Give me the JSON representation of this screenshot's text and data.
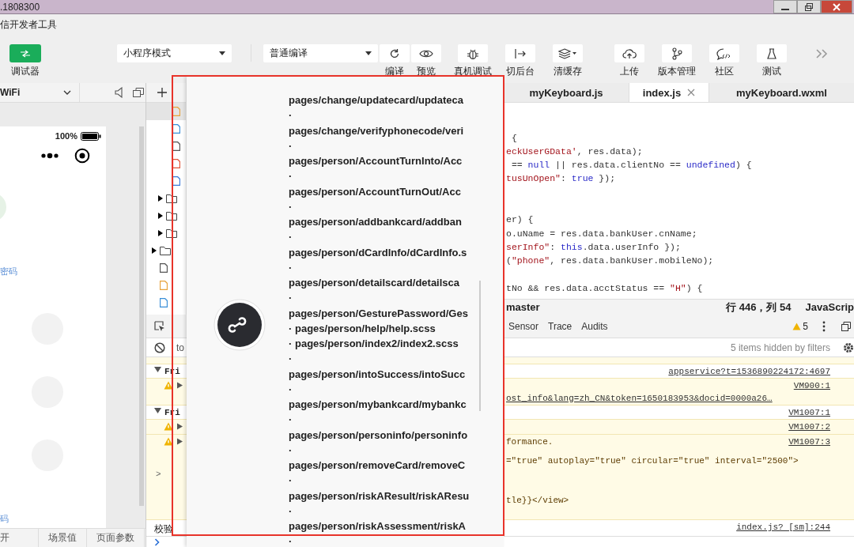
{
  "window": {
    "title": ".1808300"
  },
  "menu_bar": {
    "app_name": "信开发者工具"
  },
  "toolbar": {
    "debugger_label": "调试器",
    "mode_select": "小程序模式",
    "compile_select": "普通编译",
    "quick_actions": [
      {
        "kind": "compile",
        "label": "编译"
      },
      {
        "kind": "preview",
        "label": "预览"
      }
    ],
    "actions": [
      {
        "kind": "remote-debug",
        "label": "真机调试"
      },
      {
        "kind": "background",
        "label": "切后台"
      },
      {
        "kind": "cache",
        "label": "清缓存"
      }
    ],
    "publish_actions": [
      {
        "kind": "upload",
        "label": "上传"
      },
      {
        "kind": "version",
        "label": "版本管理"
      },
      {
        "kind": "community",
        "label": "社区"
      },
      {
        "kind": "test",
        "label": "测试"
      }
    ]
  },
  "simulator": {
    "network": "WiFi",
    "battery": "100%",
    "link_top": "密码",
    "link_bottom": "码",
    "bottom_tabs": [
      "开",
      "场景值",
      "页面参数"
    ]
  },
  "file_tree": [
    {
      "children": [
        {
          "children": [
            {
              "kind": "js",
              "selected": true
            },
            {
              "kind": "json",
              "selected": false
            },
            {
              "kind": "scss",
              "selected": false
            },
            {
              "kind": "wxml",
              "selected": false
            },
            {
              "kind": "wxss",
              "selected": false
            }
          ]
        },
        {
          "kind": "folder",
          "expanded": false,
          "selected": false
        },
        {
          "kind": "folder",
          "expanded": false,
          "selected": false
        },
        {
          "kind": "folder",
          "expanded": false,
          "selected": false
        }
      ]
    },
    {
      "kind": "folder",
      "expanded": false,
      "selected": false
    },
    {
      "kind": "file",
      "selected": false
    },
    {
      "kind": "js",
      "selected": false
    },
    {
      "kind": "json",
      "selected": false
    }
  ],
  "editor": {
    "tabs": [
      {
        "label": "myKeyboard.js",
        "selected": false
      },
      {
        "label": "index.js",
        "selected": true
      },
      {
        "label": "myKeyboard.wxml",
        "selected": false
      }
    ],
    "lines": [
      {
        "blank": true
      },
      {
        "blank": true
      },
      {
        "segments": [
          {
            "t": " {",
            "kind": "plain"
          }
        ]
      },
      {
        "segments": [
          {
            "t": "eckUserGData'",
            "kind": "string"
          },
          {
            "t": ", res.data);",
            "kind": "plain"
          }
        ]
      },
      {
        "segments": [
          {
            "t": " == ",
            "kind": "plain"
          },
          {
            "t": "null",
            "kind": "keyword"
          },
          {
            "t": " || res.data.clientNo == ",
            "kind": "plain"
          },
          {
            "t": "undefined",
            "kind": "keyword"
          },
          {
            "t": ") {",
            "kind": "plain"
          }
        ]
      },
      {
        "segments": [
          {
            "t": "tusUnOpen\"",
            "kind": "string"
          },
          {
            "t": ": ",
            "kind": "plain"
          },
          {
            "t": "true",
            "kind": "keyword"
          },
          {
            "t": " });",
            "kind": "plain"
          }
        ]
      },
      {
        "blank": true
      },
      {
        "blank": true
      },
      {
        "segments": [
          {
            "t": "er) {",
            "kind": "plain"
          }
        ]
      },
      {
        "segments": [
          {
            "t": "o.uName = res.data.bankUser.cnName;",
            "kind": "plain"
          }
        ]
      },
      {
        "segments": [
          {
            "t": "serInfo\"",
            "kind": "string"
          },
          {
            "t": ": ",
            "kind": "plain"
          },
          {
            "t": "this",
            "kind": "keyword"
          },
          {
            "t": ".data.userInfo });",
            "kind": "plain"
          }
        ]
      },
      {
        "segments": [
          {
            "t": "(",
            "kind": "plain"
          },
          {
            "t": "\"phone\"",
            "kind": "string"
          },
          {
            "t": ", res.data.bankUser.mobileNo);",
            "kind": "plain"
          }
        ]
      },
      {
        "blank": true
      },
      {
        "segments": [
          {
            "t": "tNo && res.data.acctStatus == ",
            "kind": "plain"
          },
          {
            "t": "\"H\"",
            "kind": "string"
          },
          {
            "t": ") {",
            "kind": "plain"
          }
        ]
      }
    ]
  },
  "status_bar": {
    "branch": "master",
    "position": "行 446，列 54",
    "language": "JavaScrip"
  },
  "devtools": {
    "tabs": [
      "Sensor",
      "Trace",
      "Audits"
    ],
    "warning_count": "5",
    "filter_text": "to",
    "hidden_note": "5 items hidden by filters",
    "console": [
      {
        "kind": "group",
        "label": "Fri",
        "expanded": true,
        "source": "appservice?t=1536890224172:4697"
      },
      {
        "kind": "warning",
        "expanded": false,
        "source": "VM900:1",
        "link": "ost_info&lang=zh_CN&token=1650183953&docid=0000a26…"
      },
      {
        "kind": "group",
        "label": "Fri",
        "expanded": true,
        "source": "VM1007:1"
      },
      {
        "kind": "warning",
        "expanded": false,
        "source": "VM1007:2"
      },
      {
        "kind": "warning",
        "expanded": false,
        "text": "formance.",
        "source": "VM1007:3",
        "frame_marker": ">",
        "frame_lines": [
          "=\"true\" autoplay=\"true\" circular=\"true\" interval=\"2500\">",
          "tle}}</view>"
        ]
      },
      {
        "kind": "log",
        "text": "校验",
        "source": "index.js? [sm]:244"
      }
    ]
  },
  "popup": {
    "items": [
      {
        "text": "pages/change/updatecard/updateca"
      },
      {
        "bullet": "·",
        "text": "pages/change/verifyphonecode/veri"
      },
      {
        "bullet": "·",
        "text": "pages/person/AccountTurnInto/Acc"
      },
      {
        "bullet": "·",
        "text": "pages/person/AccountTurnOut/Acc"
      },
      {
        "bullet": "·",
        "text": "pages/person/addbankcard/addban"
      },
      {
        "bullet": "·",
        "text": "pages/person/dCardInfo/dCardInfo.s"
      },
      {
        "bullet": "·",
        "text": "pages/person/detailscard/detailsca"
      },
      {
        "bullet": "·",
        "text": "pages/person/GesturePassword/Ges"
      },
      {
        "bullet": "·",
        "text": "pages/person/help/help.scss"
      },
      {
        "bullet": "·",
        "text": "pages/person/index2/index2.scss"
      },
      {
        "bullet": "·",
        "text": "pages/person/intoSuccess/intoSucc"
      },
      {
        "bullet": "·",
        "text": "pages/person/mybankcard/mybankc"
      },
      {
        "bullet": "·",
        "text": "pages/person/personinfo/personinfo"
      },
      {
        "bullet": "·",
        "text": "pages/person/removeCard/removeC"
      },
      {
        "bullet": "·",
        "text": "pages/person/riskAResult/riskAResu"
      },
      {
        "bullet": "·",
        "text": "pages/person/riskAssessment/riskA"
      },
      {
        "bullet": "·"
      }
    ]
  }
}
